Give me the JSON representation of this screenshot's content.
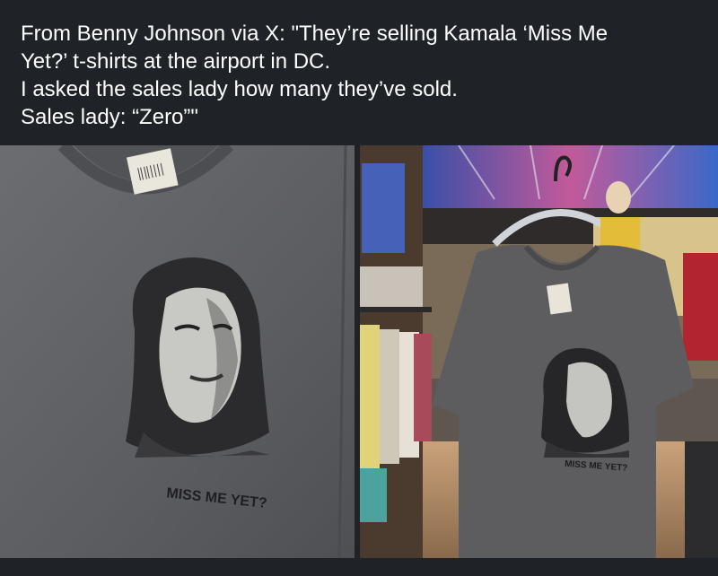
{
  "post": {
    "caption_lines": [
      "From Benny Johnson via X: \"They’re selling Kamala ‘Miss Me",
      "Yet?’ t-shirts at the airport in DC.",
      "I asked the sales lady how many they’ve sold.",
      "Sales lady: “Zero”\""
    ]
  },
  "photos": {
    "left": {
      "shirt_print": "MISS ME YET?",
      "shirt_color": "#5f6064"
    },
    "right": {
      "shirt_print": "MISS ME YET?",
      "shirt_color": "#5d5d5f"
    }
  },
  "colors": {
    "background": "#1f2327",
    "text": "#ffffff"
  }
}
